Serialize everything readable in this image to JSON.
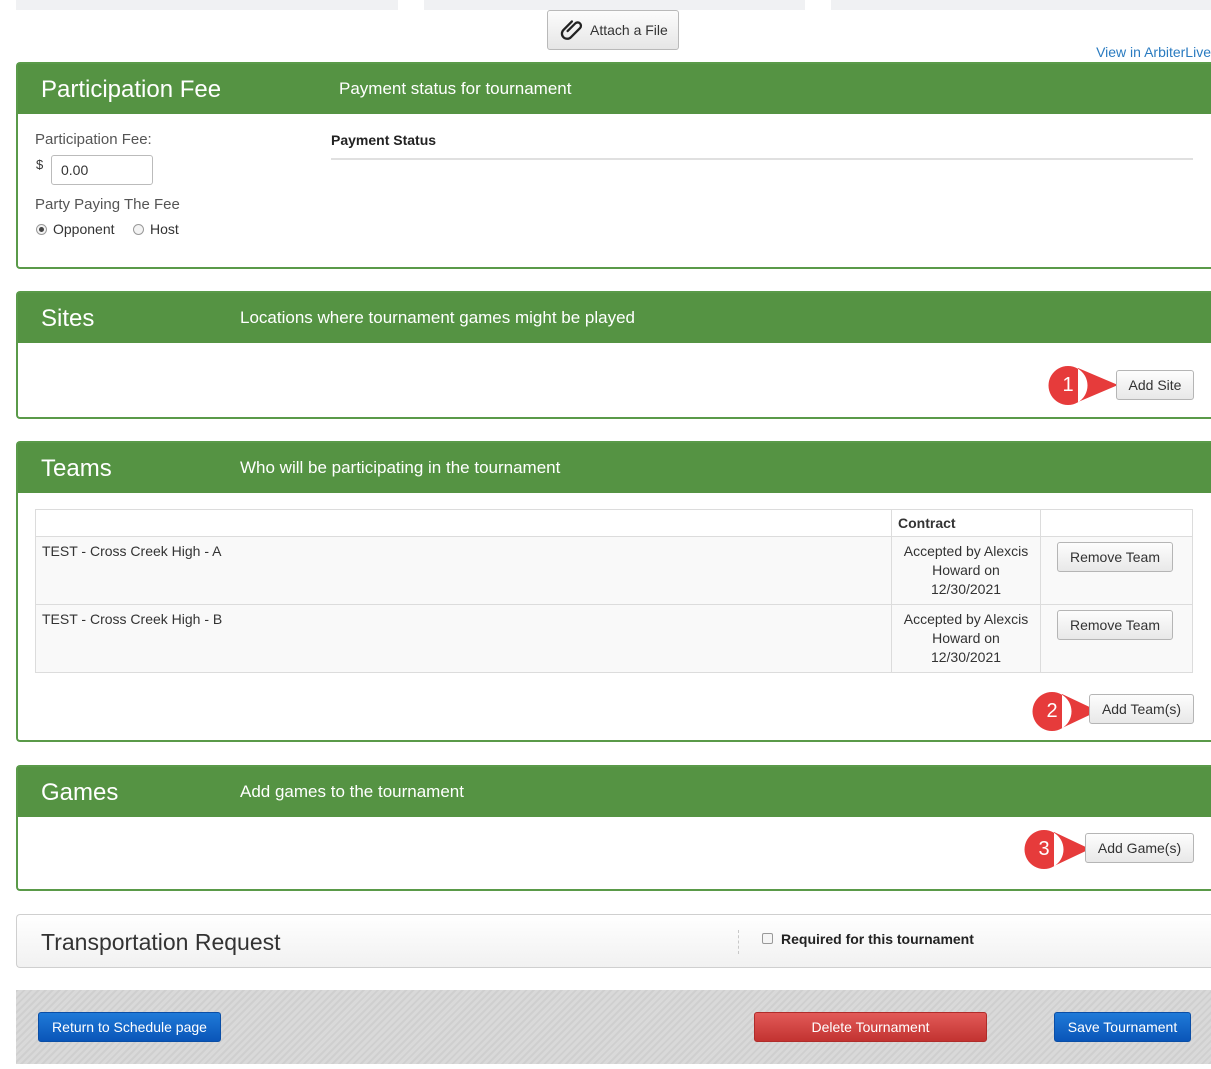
{
  "header": {
    "attach_label": "Attach a File",
    "view_link": "View in ArbiterLive"
  },
  "participation": {
    "title": "Participation Fee",
    "subtitle": "Payment status for tournament",
    "fee_label": "Participation Fee:",
    "currency": "$",
    "fee_value": "0.00",
    "party_label": "Party Paying The Fee",
    "options": [
      "Opponent",
      "Host"
    ],
    "selected": "Opponent",
    "payment_status_header": "Payment Status"
  },
  "sites": {
    "title": "Sites",
    "subtitle": "Locations where tournament games might be played",
    "add_label": "Add Site",
    "marker": "1"
  },
  "teams": {
    "title": "Teams",
    "subtitle": "Who will be participating in the tournament",
    "columns": [
      "",
      "Contract",
      ""
    ],
    "rows": [
      {
        "name": "TEST - Cross Creek High - A",
        "contract": "Accepted by Alexcis Howard on 12/30/2021",
        "action": "Remove Team"
      },
      {
        "name": "TEST - Cross Creek High - B",
        "contract": "Accepted by Alexcis Howard on 12/30/2021",
        "action": "Remove Team"
      }
    ],
    "add_label": "Add Team(s)",
    "marker": "2"
  },
  "games": {
    "title": "Games",
    "subtitle": "Add games to the tournament",
    "add_label": "Add Game(s)",
    "marker": "3"
  },
  "transportation": {
    "title": "Transportation Request",
    "required_label": "Required for this tournament",
    "required_checked": false
  },
  "footer": {
    "return_label": "Return to Schedule page",
    "delete_label": "Delete Tournament",
    "save_label": "Save Tournament"
  },
  "colors": {
    "panel_green": "#559343",
    "marker_red": "#e63b3b",
    "primary_blue": "#0a55b8",
    "danger_red": "#c23331"
  },
  "icons": {
    "attach": "paperclip-icon"
  }
}
